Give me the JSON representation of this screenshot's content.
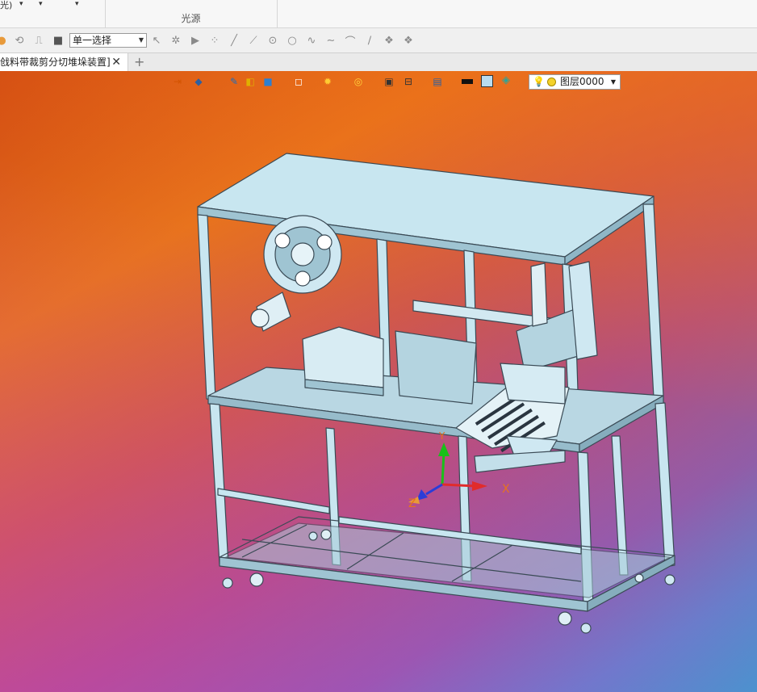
{
  "ribbon": {
    "fragment_text": "光)",
    "dropdown_arrows": [
      "▾",
      "▾",
      "▾"
    ],
    "group_label": "光源"
  },
  "toolbar": {
    "selection_mode": "单一选择",
    "icons": [
      "rotate-icon",
      "step-icon",
      "stop-icon",
      "play-icon",
      "select-cursor-icon",
      "select-faces-icon",
      "points-icon",
      "line-icon",
      "edge-icon",
      "point-circle-icon",
      "circle-icon",
      "curve-icon",
      "wave-icon",
      "arc-icon",
      "segment-icon",
      "layers-icon",
      "layers-alt-icon"
    ]
  },
  "tabs": {
    "active_document": "戗料带裁剪分切堆垛装置]",
    "close_glyph": "✕",
    "add_glyph": "+"
  },
  "view_toolbar": {
    "layer_value": "图层0000",
    "colors": {
      "black_swatch": "#111111",
      "light_swatch": "#b8dcf0"
    }
  },
  "axes": {
    "x": "X",
    "y": "Y",
    "z": "Z"
  },
  "theme": {
    "viewport_orange": "#e8731d",
    "viewport_magenta": "#c24fa8",
    "viewport_cyan": "#33a3cb",
    "frame_color": "#c8e6f0",
    "frame_stroke": "#3a4a55"
  }
}
